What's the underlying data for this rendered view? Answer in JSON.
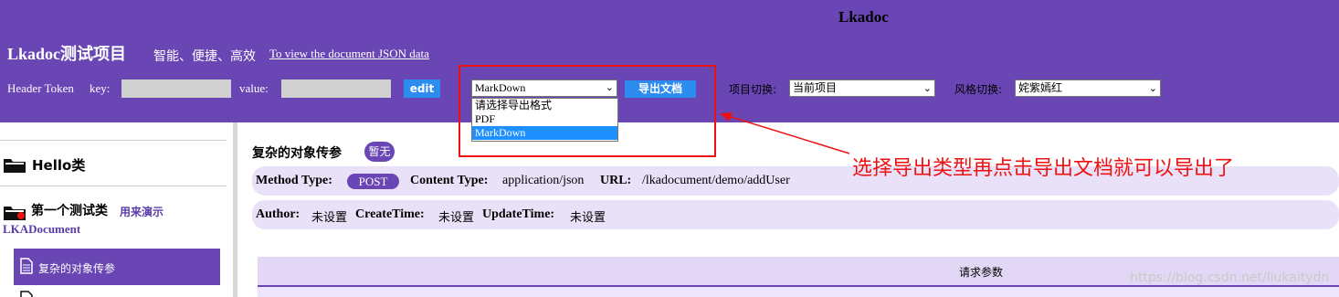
{
  "header": {
    "app_title": "Lkadoc",
    "project_title": "Lkadoc测试项目",
    "slogan": "智能、便捷、高效",
    "json_link": "To view the document JSON data",
    "token_label": "Header Token",
    "key_label": "key:",
    "value_label": "value:",
    "edit_label": "edit",
    "export_format_selected": "MarkDown",
    "export_button": "导出文档",
    "export_options": [
      "请选择导出格式",
      "PDF",
      "MarkDown"
    ],
    "project_switch_label": "项目切换:",
    "project_switch_value": "当前项目",
    "style_switch_label": "风格切换:",
    "style_switch_value": "姹紫嫣红",
    "accent_color": "#6a46b5",
    "button_color": "#2d8cf0"
  },
  "annotation": {
    "text": "选择导出类型再点击导出文档就可以导出了",
    "color": "#e11"
  },
  "sidebar": {
    "item1": "Hello类",
    "item2": "第一个测试类",
    "item2_desc": "用来演示",
    "item2_sub": "LKADocument",
    "active_item": "复杂的对象传参",
    "icons": [
      "folder-icon",
      "folder-icon",
      "document-icon"
    ]
  },
  "main": {
    "title": "复杂的对象传参",
    "badge": "暂无",
    "method_type_label": "Method Type:",
    "method_type_value": "POST",
    "content_type_label": "Content Type:",
    "content_type_value": "application/json",
    "url_label": "URL:",
    "url_value": "/lkadocument/demo/addUser",
    "author_label": "Author:",
    "author_value": "未设置",
    "create_time_label": "CreateTime:",
    "create_time_value": "未设置",
    "update_time_label": "UpdateTime:",
    "update_time_value": "未设置",
    "request_params": "请求参数"
  },
  "watermark": "https://blog.csdn.net/liukaitydn"
}
